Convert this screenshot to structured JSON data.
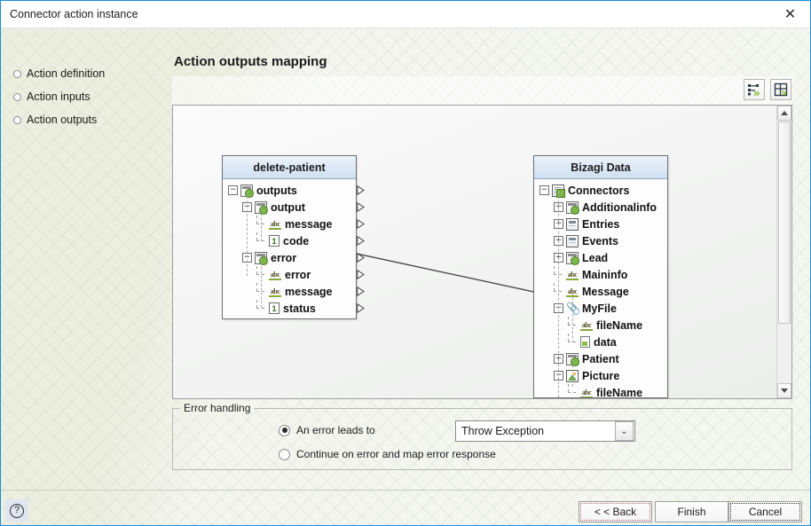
{
  "window": {
    "title": "Connector action instance",
    "close_label": "✕"
  },
  "nav": {
    "items": [
      {
        "label": "Action definition"
      },
      {
        "label": "Action inputs"
      },
      {
        "label": "Action outputs"
      }
    ]
  },
  "page": {
    "title": "Action outputs mapping"
  },
  "toolbar": {
    "buttons": [
      {
        "name": "auto-map-icon",
        "tooltip": "Auto map"
      },
      {
        "name": "layout-icon",
        "tooltip": "Arrange"
      }
    ]
  },
  "mapping": {
    "source_panel": {
      "title": "delete-patient",
      "rows": [
        {
          "label": "outputs",
          "icon": "collection-icon",
          "expander": "−",
          "indent": 0,
          "has_expander": true,
          "arrow": true
        },
        {
          "label": "output",
          "icon": "collection-icon",
          "expander": "−",
          "indent": 1,
          "has_expander": true,
          "arrow": true
        },
        {
          "label": "message",
          "icon": "abc-icon",
          "expander": "",
          "indent": 2,
          "has_expander": false,
          "arrow": true
        },
        {
          "label": "code",
          "icon": "number-icon",
          "expander": "",
          "indent": 2,
          "has_expander": false,
          "arrow": true
        },
        {
          "label": "error",
          "icon": "collection-icon",
          "expander": "−",
          "indent": 1,
          "has_expander": true,
          "arrow": true
        },
        {
          "label": "error",
          "icon": "abc-icon",
          "expander": "",
          "indent": 2,
          "has_expander": false,
          "arrow": true
        },
        {
          "label": "message",
          "icon": "abc-icon",
          "expander": "",
          "indent": 2,
          "has_expander": false,
          "arrow": true
        },
        {
          "label": "status",
          "icon": "number-icon",
          "expander": "",
          "indent": 2,
          "has_expander": false,
          "arrow": true
        }
      ]
    },
    "target_panel": {
      "title": "Bizagi Data",
      "rows": [
        {
          "label": "Connectors",
          "icon": "grid-icon",
          "expander": "−",
          "indent": 0,
          "has_expander": true,
          "arrow": true
        },
        {
          "label": "Additionalinfo",
          "icon": "collection-icon",
          "expander": "+",
          "indent": 1,
          "has_expander": true,
          "arrow": true
        },
        {
          "label": "Entries",
          "icon": "table-icon",
          "expander": "+",
          "indent": 1,
          "has_expander": true,
          "arrow": true
        },
        {
          "label": "Events",
          "icon": "table-icon",
          "expander": "+",
          "indent": 1,
          "has_expander": true,
          "arrow": true
        },
        {
          "label": "Lead",
          "icon": "collection-icon",
          "expander": "+",
          "indent": 1,
          "has_expander": true,
          "arrow": true
        },
        {
          "label": "Maininfo",
          "icon": "abc-icon",
          "expander": "",
          "indent": 1,
          "has_expander": false,
          "arrow": true
        },
        {
          "label": "Message",
          "icon": "abc-icon",
          "expander": "",
          "indent": 1,
          "has_expander": false,
          "arrow": true
        },
        {
          "label": "MyFile",
          "icon": "clip-icon",
          "expander": "−",
          "indent": 1,
          "has_expander": true,
          "arrow": true
        },
        {
          "label": "fileName",
          "icon": "abc-icon",
          "expander": "",
          "indent": 2,
          "has_expander": false,
          "arrow": true
        },
        {
          "label": "data",
          "icon": "file-icon",
          "expander": "",
          "indent": 2,
          "has_expander": false,
          "arrow": true
        },
        {
          "label": "Patient",
          "icon": "collection-icon",
          "expander": "+",
          "indent": 1,
          "has_expander": true,
          "arrow": true
        },
        {
          "label": "Picture",
          "icon": "image-icon",
          "expander": "−",
          "indent": 1,
          "has_expander": true,
          "arrow": true
        },
        {
          "label": "fileName",
          "icon": "abc-icon",
          "expander": "",
          "indent": 2,
          "has_expander": false,
          "arrow": true
        }
      ]
    },
    "connections": [
      {
        "from": "message",
        "to": "Message"
      }
    ]
  },
  "error_handling": {
    "legend": "Error handling",
    "option_leads_to": "An error leads to",
    "option_continue": "Continue on error and map error response",
    "selected_option": "leads_to",
    "dropdown_value": "Throw Exception",
    "dropdown_caret": "⌄"
  },
  "footer": {
    "help_label": "?",
    "back_label": "< < Back",
    "finish_label": "Finish",
    "cancel_label": "Cancel"
  },
  "colors": {
    "accent": "#1a8fd8",
    "panel_header": "#cfe0f2",
    "icon_green": "#7ab648"
  }
}
